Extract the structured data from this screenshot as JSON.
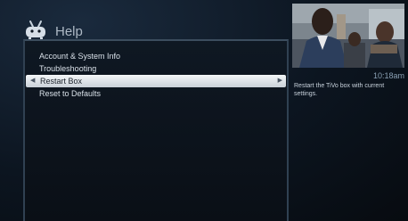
{
  "header": {
    "title": "Help",
    "icon": "tivo-logo-icon"
  },
  "menu": {
    "items": [
      {
        "label": "Account & System Info",
        "selected": false
      },
      {
        "label": "Troubleshooting",
        "selected": false
      },
      {
        "label": "Restart Box",
        "selected": true
      },
      {
        "label": "Reset to Defaults",
        "selected": false
      }
    ]
  },
  "side_panel": {
    "clock": "10:18am",
    "description": "Restart the TiVo box with current settings."
  },
  "colors": {
    "background": "#0b1016",
    "selection": "#e6eaee",
    "text": "#dfe6ee"
  }
}
